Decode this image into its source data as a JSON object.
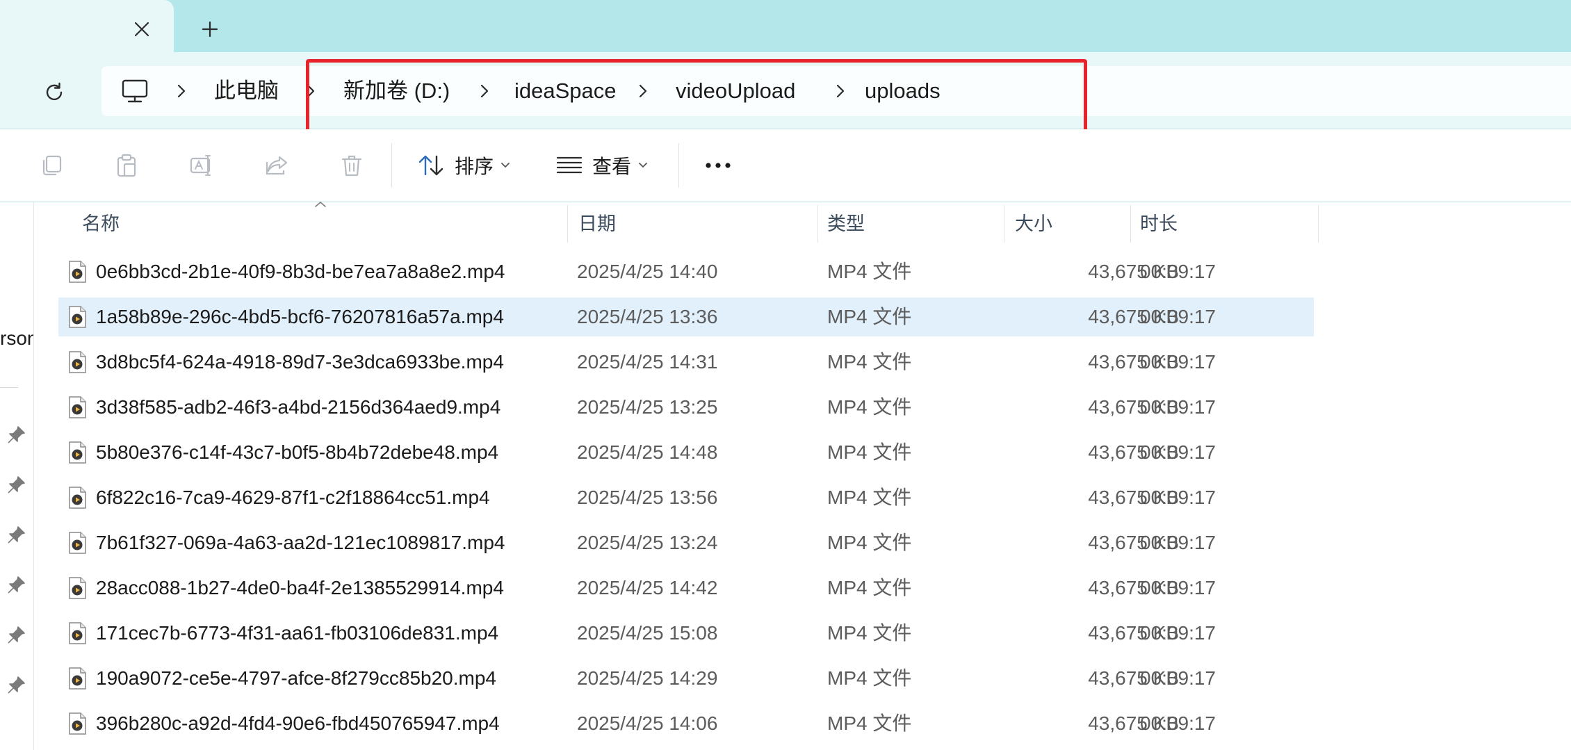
{
  "window": {
    "new_tab_label": "+"
  },
  "breadcrumb": {
    "items": [
      "此电脑",
      "新加卷 (D:)",
      "ideaSpace",
      "videoUpload",
      "uploads"
    ]
  },
  "toolbar": {
    "sort_label": "排序",
    "view_label": "查看"
  },
  "nav": {
    "partial_label": "rson"
  },
  "columns": [
    "名称",
    "日期",
    "类型",
    "大小",
    "时长"
  ],
  "files": [
    {
      "name": "0e6bb3cd-2b1e-40f9-8b3d-be7ea7a8a8e2.mp4",
      "date": "2025/4/25 14:40",
      "type": "MP4 文件",
      "size": "43,675 KB",
      "duration": "00:09:17",
      "selected": false
    },
    {
      "name": "1a58b89e-296c-4bd5-bcf6-76207816a57a.mp4",
      "date": "2025/4/25 13:36",
      "type": "MP4 文件",
      "size": "43,675 KB",
      "duration": "00:09:17",
      "selected": true
    },
    {
      "name": "3d8bc5f4-624a-4918-89d7-3e3dca6933be.mp4",
      "date": "2025/4/25 14:31",
      "type": "MP4 文件",
      "size": "43,675 KB",
      "duration": "00:09:17",
      "selected": false
    },
    {
      "name": "3d38f585-adb2-46f3-a4bd-2156d364aed9.mp4",
      "date": "2025/4/25 13:25",
      "type": "MP4 文件",
      "size": "43,675 KB",
      "duration": "00:09:17",
      "selected": false
    },
    {
      "name": "5b80e376-c14f-43c7-b0f5-8b4b72debe48.mp4",
      "date": "2025/4/25 14:48",
      "type": "MP4 文件",
      "size": "43,675 KB",
      "duration": "00:09:17",
      "selected": false
    },
    {
      "name": "6f822c16-7ca9-4629-87f1-c2f18864cc51.mp4",
      "date": "2025/4/25 13:56",
      "type": "MP4 文件",
      "size": "43,675 KB",
      "duration": "00:09:17",
      "selected": false
    },
    {
      "name": "7b61f327-069a-4a63-aa2d-121ec1089817.mp4",
      "date": "2025/4/25 13:24",
      "type": "MP4 文件",
      "size": "43,675 KB",
      "duration": "00:09:17",
      "selected": false
    },
    {
      "name": "28acc088-1b27-4de0-ba4f-2e1385529914.mp4",
      "date": "2025/4/25 14:42",
      "type": "MP4 文件",
      "size": "43,675 KB",
      "duration": "00:09:17",
      "selected": false
    },
    {
      "name": "171cec7b-6773-4f31-aa61-fb03106de831.mp4",
      "date": "2025/4/25 15:08",
      "type": "MP4 文件",
      "size": "43,675 KB",
      "duration": "00:09:17",
      "selected": false
    },
    {
      "name": "190a9072-ce5e-4797-afce-8f279cc85b20.mp4",
      "date": "2025/4/25 14:29",
      "type": "MP4 文件",
      "size": "43,675 KB",
      "duration": "00:09:17",
      "selected": false
    },
    {
      "name": "396b280c-a92d-4fd4-90e6-fbd450765947.mp4",
      "date": "2025/4/25 14:06",
      "type": "MP4 文件",
      "size": "43,675 KB",
      "duration": "00:09:17",
      "selected": false
    }
  ],
  "colors": {
    "tab_strip": "#b4e7ea",
    "address_area": "#e8f8f9",
    "highlight_box": "#e8242a",
    "selected_row": "#e2f0fb"
  }
}
